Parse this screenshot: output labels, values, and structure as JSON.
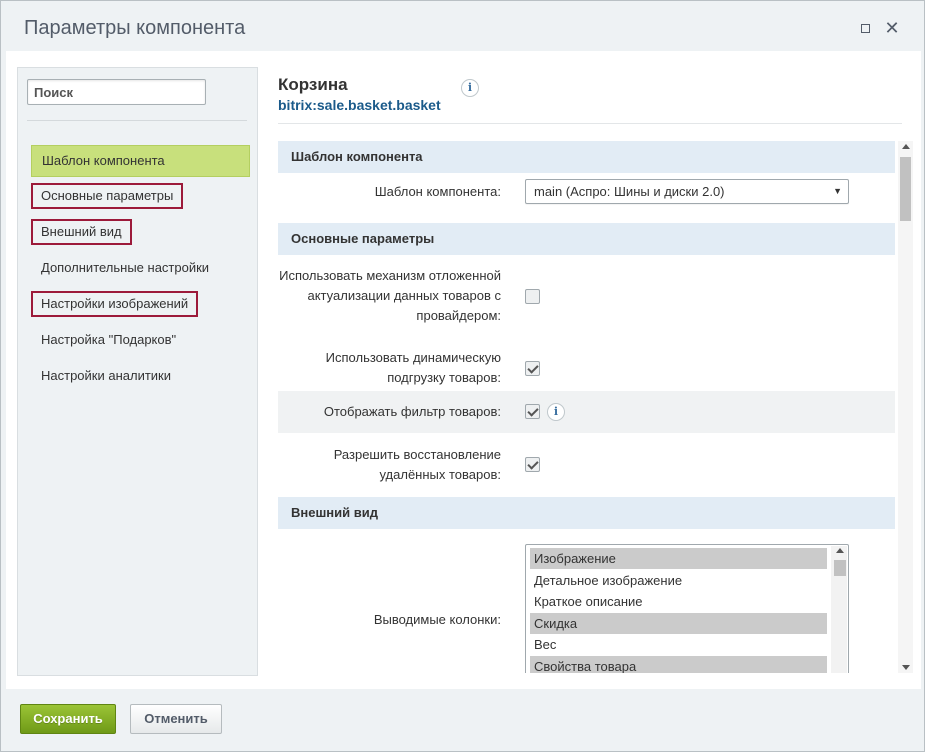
{
  "window": {
    "title": "Параметры компонента",
    "maximize_icon": "maximize-icon",
    "close_glyph": "✕"
  },
  "sidebar": {
    "search_placeholder": "Поиск",
    "items": [
      {
        "label": "Шаблон компонента",
        "active": true,
        "highlighted": false
      },
      {
        "label": "Основные параметры",
        "active": false,
        "highlighted": true
      },
      {
        "label": "Внешний вид",
        "active": false,
        "highlighted": true
      },
      {
        "label": "Дополнительные настройки",
        "active": false,
        "highlighted": false
      },
      {
        "label": "Настройки изображений",
        "active": false,
        "highlighted": true
      },
      {
        "label": "Настройка \"Подарков\"",
        "active": false,
        "highlighted": false
      },
      {
        "label": "Настройки аналитики",
        "active": false,
        "highlighted": false
      }
    ]
  },
  "component": {
    "title": "Корзина",
    "code": "bitrix:sale.basket.basket",
    "info_glyph": "i"
  },
  "sections": {
    "template": {
      "header": "Шаблон компонента",
      "template_label": "Шаблон компонента:",
      "template_value": "main (Аспро: Шины и диски 2.0)",
      "arrow": "▼"
    },
    "main": {
      "header": "Основные параметры",
      "fields": [
        {
          "label": "Использовать механизм отложенной актуализации данных товаров с провайдером:",
          "checked": false
        },
        {
          "label": "Использовать динамическую подгрузку товаров:",
          "checked": true
        },
        {
          "label": "Отображать фильтр товаров:",
          "checked": true
        },
        {
          "label": "Разрешить восстановление удалённых товаров:",
          "checked": true
        }
      ]
    },
    "view": {
      "header": "Внешний вид",
      "columns_label": "Выводимые колонки:",
      "columns_options": [
        {
          "label": "Изображение",
          "selected": true
        },
        {
          "label": "Детальное изображение",
          "selected": false
        },
        {
          "label": "Краткое описание",
          "selected": false
        },
        {
          "label": "Скидка",
          "selected": true
        },
        {
          "label": "Вес",
          "selected": false
        },
        {
          "label": "Свойства товара",
          "selected": true
        }
      ]
    }
  },
  "footer": {
    "save_label": "Сохранить",
    "cancel_label": "Отменить"
  },
  "colors": {
    "accent_green": "#87b123",
    "highlight_border": "#9c1a3a",
    "section_bg": "#e2ecf5",
    "link_blue": "#1a5a8a"
  }
}
